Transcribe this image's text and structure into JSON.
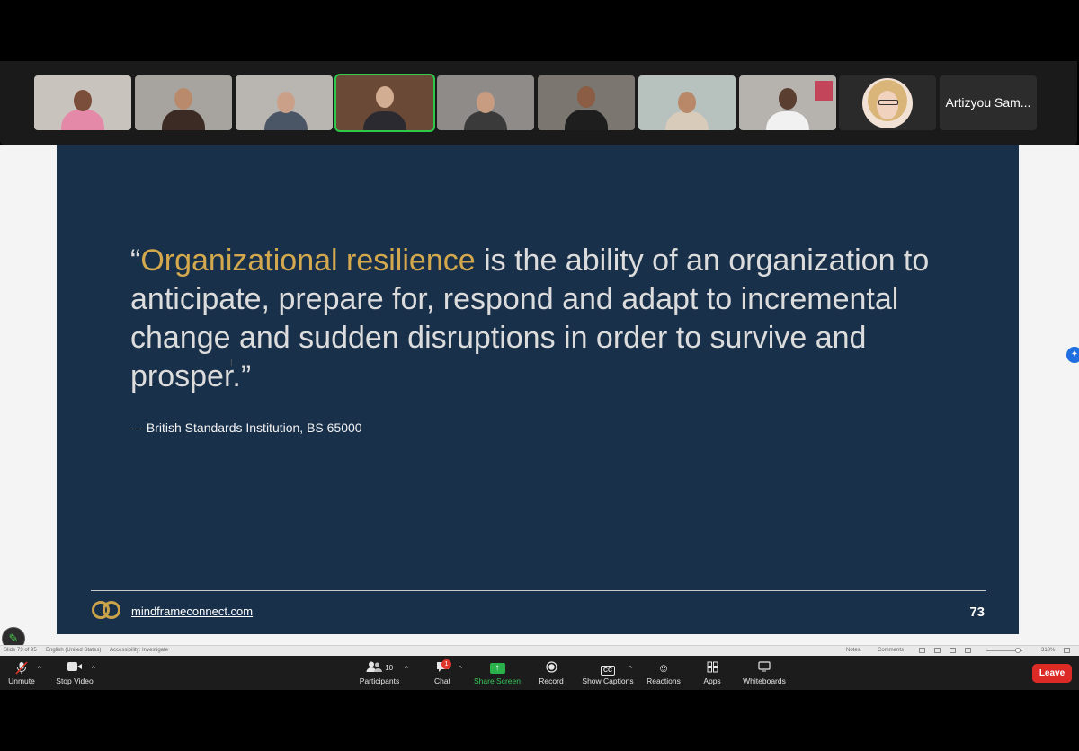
{
  "slide": {
    "quote_open": "“",
    "quote_highlight": "Organizational resilience",
    "quote_rest": " is the ability of an organization to anticipate, prepare for, respond and adapt to incremental change and sudden disruptions in order to survive and prosper.”",
    "attribution": "— British Standards Institution, BS 65000",
    "footer_link": "mindframeconnect.com",
    "slide_number": "73",
    "highlight_color": "#d4a94e",
    "background_color": "#19304a"
  },
  "ppt_status": {
    "slide_position": "Slide 73 of 95",
    "language": "English (United States)",
    "accessibility": "Accessibility: Investigate",
    "notes": "Notes",
    "comments": "Comments",
    "zoom": "318%"
  },
  "gallery": {
    "name_tile_label": "Artizyou Sam...",
    "active_speaker_color": "#2fc94a"
  },
  "toolbar": {
    "unmute_label": "Unmute",
    "stop_video_label": "Stop Video",
    "participants_label": "Participants",
    "participants_count": "10",
    "chat_label": "Chat",
    "chat_badge": "1",
    "share_screen_label": "Share Screen",
    "record_label": "Record",
    "captions_label": "Show Captions",
    "captions_icon_text": "CC",
    "reactions_label": "Reactions",
    "apps_label": "Apps",
    "whiteboards_label": "Whiteboards",
    "leave_label": "Leave",
    "share_color": "#2bb04a",
    "leave_color": "#dc2a27"
  }
}
